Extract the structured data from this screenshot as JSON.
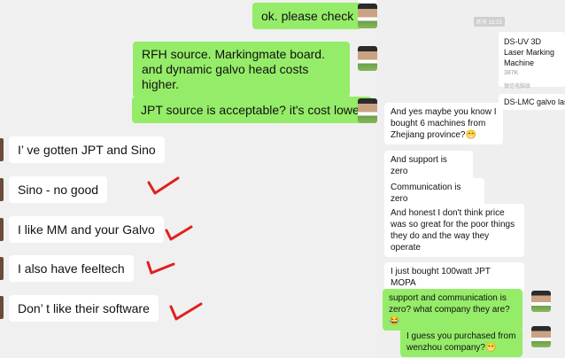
{
  "left_chat": {
    "sent": [
      "ok. please check",
      "RFH source. Markingmate  board. and dynamic galvo head costs higher.",
      "JPT source is acceptable? it's cost lower"
    ],
    "received": [
      "I’  ve gotten JPT and Sino",
      "Sino - no good",
      "I like MM and your Galvo",
      "I also have feeltech",
      "Don’ t like their software"
    ]
  },
  "right_chat": {
    "timestamp": "昨天 12:23",
    "file_card": {
      "title": "DS-UV 3D Laser Marking Machine",
      "size": "387K",
      "footer": "微信电脑版"
    },
    "file_card2_title": "DS-LMC galvo las",
    "received": [
      "And yes maybe you know I bought 6 machines from Zhejiang province?😁",
      "And support is zero",
      "Communication is zero",
      "And honest I don't think price was so great for the poor things they do and the way they operate",
      "I just bought 100watt JPT MOPA"
    ],
    "sent": [
      "support and communication is zero? what company they are?😂",
      "I guess you purchased from wenzhou company?😁"
    ]
  },
  "colors": {
    "sent_bubble": "#95ec69",
    "received_bubble": "#ffffff",
    "check_mark": "#e02020"
  }
}
